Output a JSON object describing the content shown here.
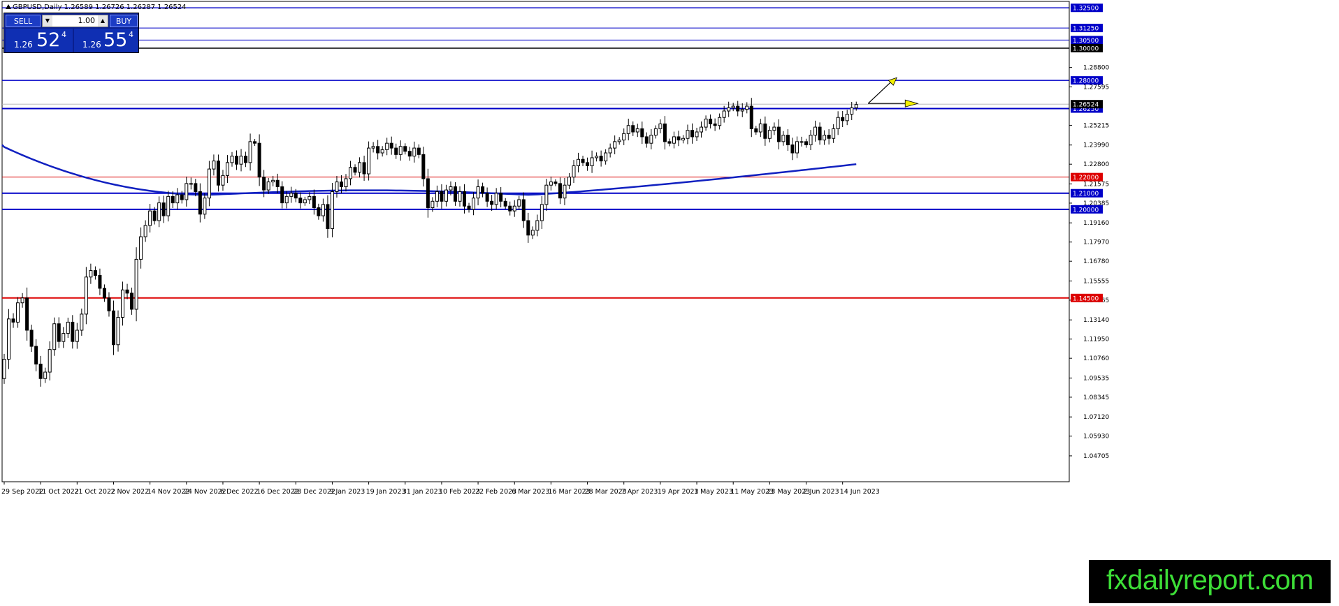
{
  "window": {
    "symbol_line": "GBPUSD,Daily  1.26589 1.26726 1.26287 1.26524"
  },
  "trade_panel": {
    "sell_label": "SELL",
    "buy_label": "BUY",
    "lot": "1.00",
    "sell_prefix": "1.26",
    "sell_big": "52",
    "sell_sup": "4",
    "buy_prefix": "1.26",
    "buy_big": "55",
    "buy_sup": "4"
  },
  "watermark": "fxdailyreport.com",
  "colors": {
    "background": "#ffffff",
    "blue_level": "#0000c8",
    "red_level": "#dd0000",
    "ma_line": "#1020c0",
    "current_price_tag": "#000000",
    "arrow_yellow": "#f4f000",
    "watermark_bg": "#000000",
    "watermark_text": "#3dde37"
  },
  "chart_data": {
    "type": "candlestick",
    "symbol": "GBPUSD",
    "timeframe": "Daily",
    "ylim": [
      1.031,
      1.329
    ],
    "y_ticks": [
      "1.28800",
      "1.27595",
      "1.25215",
      "1.23990",
      "1.22800",
      "1.21575",
      "1.20385",
      "1.19160",
      "1.17970",
      "1.16780",
      "1.15555",
      "1.14365",
      "1.13140",
      "1.11950",
      "1.10760",
      "1.09535",
      "1.08345",
      "1.07120",
      "1.05930",
      "1.04705"
    ],
    "y_tick_values": [
      1.288,
      1.27595,
      1.25215,
      1.2399,
      1.228,
      1.21575,
      1.20385,
      1.1916,
      1.1797,
      1.1678,
      1.15555,
      1.14365,
      1.1314,
      1.1195,
      1.1076,
      1.09535,
      1.08345,
      1.0712,
      1.0593,
      1.04705
    ],
    "x_labels": [
      {
        "label": "29 Sep 2022",
        "index": 0
      },
      {
        "label": "11 Oct 2022",
        "index": 8
      },
      {
        "label": "21 Oct 2022",
        "index": 16
      },
      {
        "label": "2 Nov 2022",
        "index": 24
      },
      {
        "label": "14 Nov 2022",
        "index": 32
      },
      {
        "label": "24 Nov 2022",
        "index": 40
      },
      {
        "label": "6 Dec 2022",
        "index": 48
      },
      {
        "label": "16 Dec 2022",
        "index": 56
      },
      {
        "label": "28 Dec 2022",
        "index": 64
      },
      {
        "label": "9 Jan 2023",
        "index": 72
      },
      {
        "label": "19 Jan 2023",
        "index": 80
      },
      {
        "label": "31 Jan 2023",
        "index": 88
      },
      {
        "label": "10 Feb 2023",
        "index": 96
      },
      {
        "label": "22 Feb 2023",
        "index": 104
      },
      {
        "label": "6 Mar 2023",
        "index": 112
      },
      {
        "label": "16 Mar 2023",
        "index": 120
      },
      {
        "label": "28 Mar 2023",
        "index": 128
      },
      {
        "label": "7 Apr 2023",
        "index": 136
      },
      {
        "label": "19 Apr 2023",
        "index": 144
      },
      {
        "label": "1 May 2023",
        "index": 152
      },
      {
        "label": "11 May 2023",
        "index": 160
      },
      {
        "label": "23 May 2023",
        "index": 168
      },
      {
        "label": "2 Jun 2023",
        "index": 176
      },
      {
        "label": "14 Jun 2023",
        "index": 184
      }
    ],
    "levels": [
      {
        "price": 1.325,
        "label": "1.32500",
        "color": "#0000c8",
        "width": 1.5,
        "tag": "#0000c8"
      },
      {
        "price": 1.3125,
        "label": "1.31250",
        "color": "#0000c8",
        "width": 1,
        "tag": "#0000c8"
      },
      {
        "price": 1.305,
        "label": "1.30500",
        "color": "#0000c8",
        "width": 1,
        "tag": "#0000c8"
      },
      {
        "price": 1.3,
        "label": "1.30000",
        "color": "#000000",
        "width": 1.5,
        "tag": "#000000"
      },
      {
        "price": 1.28,
        "label": "1.28000",
        "color": "#0000c8",
        "width": 1.5,
        "tag": "#0000c8"
      },
      {
        "price": 1.2625,
        "label": "1.26250",
        "color": "#0000c8",
        "width": 2,
        "tag": "#0000c8"
      },
      {
        "price": 1.22,
        "label": "1.22000",
        "color": "#dd0000",
        "width": 1,
        "tag": "#dd0000"
      },
      {
        "price": 1.21,
        "label": "1.21000",
        "color": "#0000c8",
        "width": 2,
        "tag": "#0000c8"
      },
      {
        "price": 1.2,
        "label": "1.20000",
        "color": "#0000c8",
        "width": 2,
        "tag": "#0000c8"
      },
      {
        "price": 1.145,
        "label": "1.14500",
        "color": "#dd0000",
        "width": 2,
        "tag": "#dd0000"
      }
    ],
    "current_price": {
      "price": 1.26524,
      "label": "1.26524"
    },
    "closes": [
      1.107,
      1.132,
      1.13,
      1.142,
      1.145,
      1.125,
      1.115,
      1.104,
      1.095,
      1.099,
      1.113,
      1.129,
      1.118,
      1.123,
      1.13,
      1.118,
      1.125,
      1.135,
      1.158,
      1.162,
      1.159,
      1.151,
      1.145,
      1.137,
      1.116,
      1.133,
      1.15,
      1.148,
      1.138,
      1.169,
      1.183,
      1.19,
      1.199,
      1.193,
      1.204,
      1.196,
      1.208,
      1.204,
      1.209,
      1.206,
      1.216,
      1.216,
      1.211,
      1.197,
      1.207,
      1.225,
      1.23,
      1.215,
      1.221,
      1.229,
      1.233,
      1.228,
      1.233,
      1.229,
      1.242,
      1.241,
      1.22,
      1.212,
      1.217,
      1.218,
      1.214,
      1.204,
      1.208,
      1.21,
      1.207,
      1.204,
      1.206,
      1.208,
      1.201,
      1.196,
      1.203,
      1.188,
      1.211,
      1.217,
      1.214,
      1.219,
      1.226,
      1.223,
      1.229,
      1.222,
      1.238,
      1.239,
      1.235,
      1.237,
      1.241,
      1.238,
      1.234,
      1.239,
      1.236,
      1.233,
      1.238,
      1.234,
      1.219,
      1.201,
      1.205,
      1.211,
      1.205,
      1.212,
      1.214,
      1.205,
      1.211,
      1.202,
      1.2,
      1.207,
      1.214,
      1.21,
      1.205,
      1.203,
      1.21,
      1.205,
      1.202,
      1.199,
      1.202,
      1.206,
      1.193,
      1.184,
      1.187,
      1.193,
      1.203,
      1.215,
      1.217,
      1.216,
      1.207,
      1.215,
      1.22,
      1.227,
      1.231,
      1.229,
      1.227,
      1.232,
      1.233,
      1.23,
      1.235,
      1.238,
      1.242,
      1.243,
      1.247,
      1.252,
      1.248,
      1.25,
      1.245,
      1.241,
      1.246,
      1.25,
      1.253,
      1.242,
      1.241,
      1.245,
      1.243,
      1.244,
      1.249,
      1.245,
      1.248,
      1.251,
      1.256,
      1.253,
      1.252,
      1.257,
      1.261,
      1.263,
      1.264,
      1.261,
      1.262,
      1.264,
      1.25,
      1.248,
      1.253,
      1.244,
      1.249,
      1.251,
      1.242,
      1.246,
      1.24,
      1.235,
      1.242,
      1.242,
      1.24,
      1.246,
      1.251,
      1.243,
      1.246,
      1.244,
      1.25,
      1.257,
      1.255,
      1.259,
      1.263,
      1.265
    ],
    "moving_average": {
      "start_value": 1.24,
      "min_value": 1.209,
      "end_value": 1.228
    },
    "annotations": [
      {
        "type": "arrow",
        "direction": "up-right",
        "color": "#f4f000"
      },
      {
        "type": "arrow",
        "direction": "right",
        "color": "#f4f000"
      }
    ],
    "grid": false
  }
}
